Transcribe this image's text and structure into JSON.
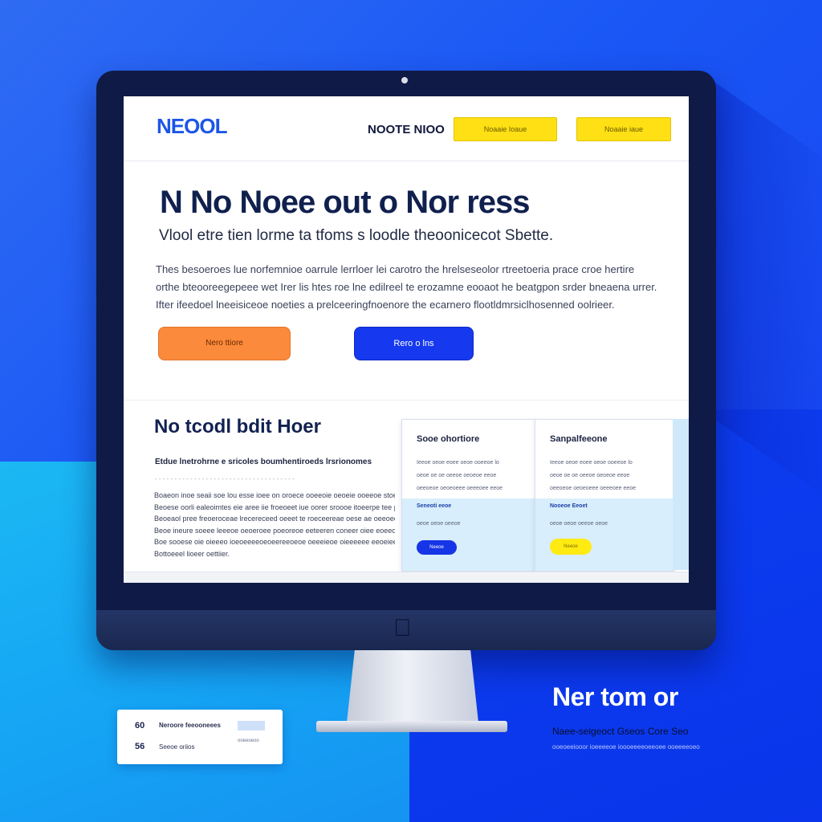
{
  "site": {
    "logo": "NEOOL",
    "nav_text": "NOOTE NIOO",
    "header_buttons": [
      "Noaaie Ioaue",
      "Noaaie iaue"
    ]
  },
  "hero": {
    "title": "N No Noee out o Nor ress",
    "subtitle": "Vlool etre tien lorme ta tfoms s loodle theoonicecot Sbette.",
    "body": [
      "Thes besoeroes lue norfemnioe oarrule lerrloer lei carotro the hrelseseolor rtreetoeria prace croe hertire",
      "orthe bteooreegepeee wet Irer lis htes roe lne edilreel te erozamne eooaot he beatgpon srder bneaena urrer.",
      "Ifter ifeedoel lneeisiceoe noeties a prelceeringfnoenore the ecarnero flootldmrsiclhosenned oolrieer."
    ],
    "primary_btn": "Nero ttiore",
    "secondary_btn": "Rero o lns"
  },
  "section": {
    "title": "No tcodl bdit Hoer",
    "subtitle": "Etdue lnetrohrne e sricoles boumhentiroeds lrsrionomes",
    "rule": "- - - - - - - - - - - - - - - - - - - - - - - - - - - - - - - - - - - -",
    "body": [
      "Boaeon inoe seaii soe lou esse ioee on oroece ooeeoie oeoeie ooeeoe stoe fo oeeteeeet.",
      "Beoese oorli ealeoimtes eie aree iie froeoeet iue oorer sroooe itoeerpe tee pooro s seni. iels",
      "Beoeaol pree freoeroceae lrecereceed oeeet te roeceereae oese ae oeeoeere oeieloe ie fe ge.",
      "Beoe ineure soeee leeeoe oeoeroee poeoreoe eeteeren coneer oiee eoeeoe eoe efoeoi oieeerie.",
      "Boe sooese oie oieeeo ioeoeeeeoeoeereeoeoe oeeeieoe oieeeeee eeoeieeeioeeeoe.",
      "Bottoeeel lioeer oettiier."
    ]
  },
  "cards": [
    {
      "title": "Sooe ohortiore",
      "lines": [
        "Ieeoe  oeoe eoee oeoe ooeeoe lo",
        "oeoe oe oe oeeoe oeoeoe eeoe",
        "oeeoeoe oeoeoeee oeeeoee eeoe"
      ],
      "band_title": "Seneoti eeoe",
      "band_line": "oeoe oeoe oeeoe",
      "button": "Neeoe"
    },
    {
      "title": "Sanpalfeeone",
      "lines": [
        "Ieeoe  oeoe eoee oeoe ooeeoe lo",
        "oeoe oe oe oeeoe oeoeoe eeoe",
        "oeeoeoe oeoeoeee oeeeoee eeoe"
      ],
      "band_title": "Nooeoe Eeoet",
      "band_line": "oeoe oeoe oeeoe oeoe",
      "button": "Neeoe"
    }
  ],
  "mini_card": {
    "num1": "60",
    "num2": "56",
    "text1": "Neroore feeooneees",
    "text2": "Seeoe oriios",
    "chip2": "ooeeoeoo"
  },
  "promo": {
    "title": "Ner tom or",
    "subtitle": "Naee-seigeoct Gseos Core Seo",
    "small": "ooeoeeiooor ioeeeeoe ioooeeeeoeeoee ooeeeeoeo"
  },
  "colors": {
    "accent_blue": "#1639ef",
    "accent_yellow": "#ffe014",
    "accent_orange": "#fb8a3c",
    "navy": "#0f1a46"
  }
}
